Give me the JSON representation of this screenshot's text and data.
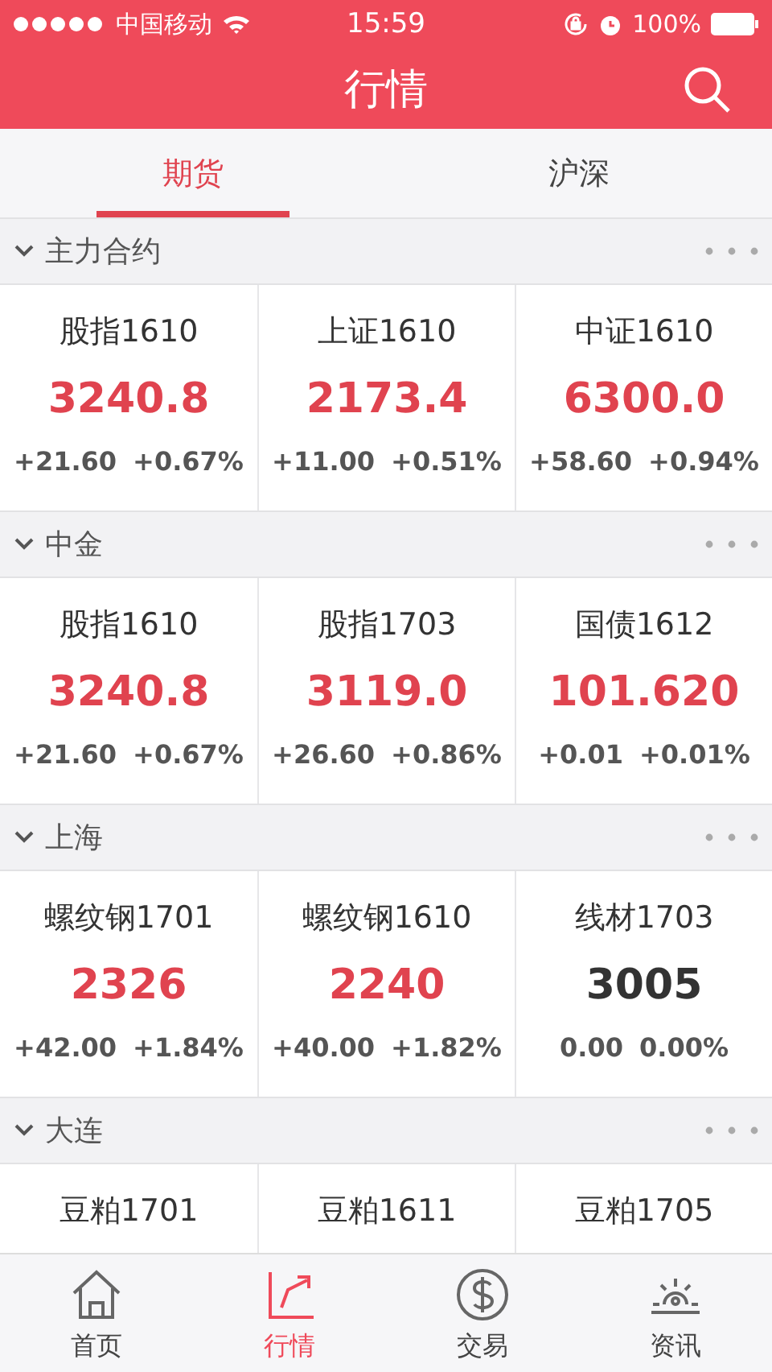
{
  "status_bar": {
    "carrier": "中国移动",
    "time": "15:59",
    "battery": "100%"
  },
  "header": {
    "title": "行情"
  },
  "tabs": [
    {
      "label": "期货",
      "selected": true
    },
    {
      "label": "沪深",
      "selected": false
    }
  ],
  "sections": [
    {
      "title": "主力合约",
      "expanded": true,
      "quotes": [
        {
          "name": "股指1610",
          "price": "3240.8",
          "change": "+21.60",
          "percent": "+0.67%",
          "color": "#e0434f"
        },
        {
          "name": "上证1610",
          "price": "2173.4",
          "change": "+11.00",
          "percent": "+0.51%",
          "color": "#e0434f"
        },
        {
          "name": "中证1610",
          "price": "6300.0",
          "change": "+58.60",
          "percent": "+0.94%",
          "color": "#e0434f"
        }
      ]
    },
    {
      "title": "中金",
      "expanded": true,
      "quotes": [
        {
          "name": "股指1610",
          "price": "3240.8",
          "change": "+21.60",
          "percent": "+0.67%",
          "color": "#e0434f"
        },
        {
          "name": "股指1703",
          "price": "3119.0",
          "change": "+26.60",
          "percent": "+0.86%",
          "color": "#e0434f"
        },
        {
          "name": "国债1612",
          "price": "101.620",
          "change": "+0.01",
          "percent": "+0.01%",
          "color": "#e0434f"
        }
      ]
    },
    {
      "title": "上海",
      "expanded": true,
      "quotes": [
        {
          "name": "螺纹钢1701",
          "price": "2326",
          "change": "+42.00",
          "percent": "+1.84%",
          "color": "#e0434f"
        },
        {
          "name": "螺纹钢1610",
          "price": "2240",
          "change": "+40.00",
          "percent": "+1.82%",
          "color": "#e0434f"
        },
        {
          "name": "线材1703",
          "price": "3005",
          "change": "0.00",
          "percent": "0.00%",
          "color": "#333333"
        }
      ]
    },
    {
      "title": "大连",
      "expanded": true,
      "quotes": [
        {
          "name": "豆粕1701"
        },
        {
          "name": "豆粕1611"
        },
        {
          "name": "豆粕1705"
        }
      ]
    }
  ],
  "tab_bar": [
    {
      "label": "首页",
      "kind": "home",
      "selected": false
    },
    {
      "label": "行情",
      "kind": "chart",
      "selected": true
    },
    {
      "label": "交易",
      "kind": "dollar",
      "selected": false
    },
    {
      "label": "资讯",
      "kind": "news",
      "selected": false
    }
  ]
}
